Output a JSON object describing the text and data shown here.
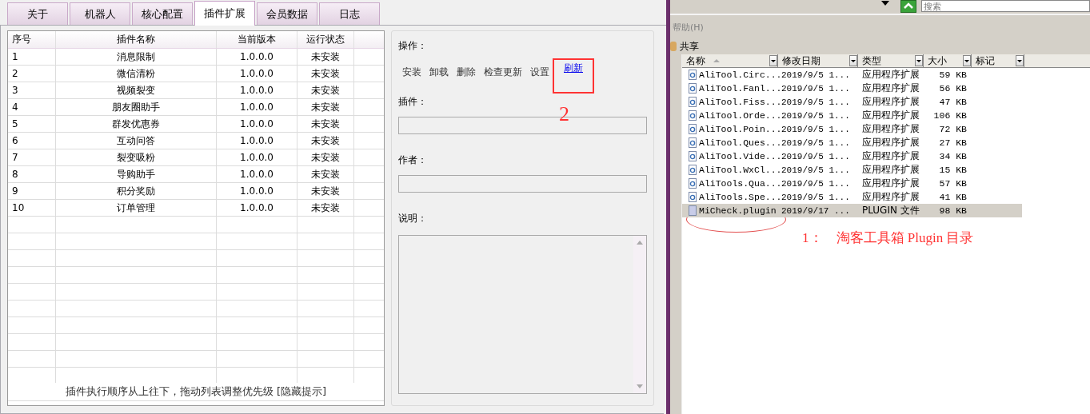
{
  "tabs": [
    {
      "label": "关于",
      "selected": false
    },
    {
      "label": "机器人",
      "selected": false
    },
    {
      "label": "核心配置",
      "selected": false
    },
    {
      "label": "插件扩展",
      "selected": true
    },
    {
      "label": "会员数据",
      "selected": false
    },
    {
      "label": "日志",
      "selected": false
    }
  ],
  "plugin_table": {
    "columns": [
      "序号",
      "插件名称",
      "当前版本",
      "运行状态"
    ],
    "rows": [
      [
        "1",
        "消息限制",
        "1.0.0.0",
        "未安装"
      ],
      [
        "2",
        "微信清粉",
        "1.0.0.0",
        "未安装"
      ],
      [
        "3",
        "视频裂变",
        "1.0.0.0",
        "未安装"
      ],
      [
        "4",
        "朋友圈助手",
        "1.0.0.0",
        "未安装"
      ],
      [
        "5",
        "群发优惠券",
        "1.0.0.0",
        "未安装"
      ],
      [
        "6",
        "互动问答",
        "1.0.0.0",
        "未安装"
      ],
      [
        "7",
        "裂变吸粉",
        "1.0.0.0",
        "未安装"
      ],
      [
        "8",
        "导购助手",
        "1.0.0.0",
        "未安装"
      ],
      [
        "9",
        "积分奖励",
        "1.0.0.0",
        "未安装"
      ],
      [
        "10",
        "订单管理",
        "1.0.0.0",
        "未安装"
      ]
    ]
  },
  "hint": "插件执行顺序从上往下，拖动列表调整优先级",
  "hint_link": "[隐藏提示]",
  "operations": {
    "label": "操作：",
    "actions": [
      {
        "label": "安装",
        "kind": "text",
        "highlighted": false
      },
      {
        "label": "卸载",
        "kind": "text",
        "highlighted": false
      },
      {
        "label": "删除",
        "kind": "text",
        "highlighted": false
      },
      {
        "label": "检查更新",
        "kind": "text",
        "highlighted": false
      },
      {
        "label": "设置",
        "kind": "text",
        "highlighted": false
      },
      {
        "label": "刷新",
        "kind": "link",
        "highlighted": true
      }
    ]
  },
  "fields": [
    {
      "label": "插件："
    },
    {
      "label": "作者："
    }
  ],
  "description": {
    "label": "说明："
  },
  "explorer": {
    "search": {
      "placeholder": "搜索"
    },
    "menu": "帮助(H)",
    "toolbar": [
      "共享"
    ],
    "columns": [
      "名称",
      "修改日期",
      "类型",
      "大小",
      "标记"
    ],
    "files": [
      {
        "name": "AliTool.Circ...",
        "date": "2019/9/5 1...",
        "type": "应用程序扩展",
        "size": "59 KB",
        "kind": "extension",
        "selected": false,
        "circled": false
      },
      {
        "name": "AliTool.Fanl...",
        "date": "2019/9/5 1...",
        "type": "应用程序扩展",
        "size": "56 KB",
        "kind": "extension",
        "selected": false,
        "circled": false
      },
      {
        "name": "AliTool.Fiss...",
        "date": "2019/9/5 1...",
        "type": "应用程序扩展",
        "size": "47 KB",
        "kind": "extension",
        "selected": false,
        "circled": false
      },
      {
        "name": "AliTool.Orde...",
        "date": "2019/9/5 1...",
        "type": "应用程序扩展",
        "size": "106 KB",
        "kind": "extension",
        "selected": false,
        "circled": false
      },
      {
        "name": "AliTool.Poin...",
        "date": "2019/9/5 1...",
        "type": "应用程序扩展",
        "size": "72 KB",
        "kind": "extension",
        "selected": false,
        "circled": false
      },
      {
        "name": "AliTool.Ques...",
        "date": "2019/9/5 1...",
        "type": "应用程序扩展",
        "size": "27 KB",
        "kind": "extension",
        "selected": false,
        "circled": false
      },
      {
        "name": "AliTool.Vide...",
        "date": "2019/9/5 1...",
        "type": "应用程序扩展",
        "size": "34 KB",
        "kind": "extension",
        "selected": false,
        "circled": false
      },
      {
        "name": "AliTool.WxCl...",
        "date": "2019/9/5 1...",
        "type": "应用程序扩展",
        "size": "15 KB",
        "kind": "extension",
        "selected": false,
        "circled": false
      },
      {
        "name": "AliTools.Qua...",
        "date": "2019/9/5 1...",
        "type": "应用程序扩展",
        "size": "57 KB",
        "kind": "extension",
        "selected": false,
        "circled": false
      },
      {
        "name": "AliTools.Spe...",
        "date": "2019/9/5 1...",
        "type": "应用程序扩展",
        "size": "41 KB",
        "kind": "extension",
        "selected": false,
        "circled": false
      },
      {
        "name": "MiCheck.plugin",
        "date": "2019/9/17 ...",
        "type": "PLUGIN 文件",
        "size": "98 KB",
        "kind": "file",
        "selected": true,
        "circled": true
      }
    ]
  },
  "annotations": [
    {
      "kind": "number",
      "text": "2"
    },
    {
      "kind": "caption",
      "text": "1：　淘客工具箱 Plugin 目录"
    }
  ]
}
